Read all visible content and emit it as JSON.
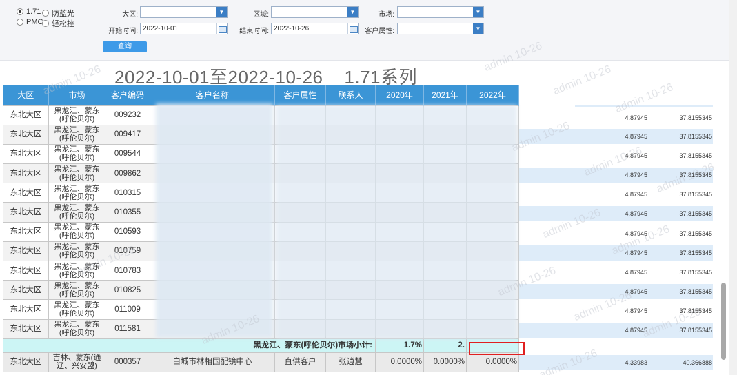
{
  "filters": {
    "radios": [
      {
        "label": "1.71",
        "checked": true
      },
      {
        "label": "防蓝光",
        "checked": false
      },
      {
        "label": "PMC",
        "checked": false
      },
      {
        "label": "轻松控",
        "checked": false
      }
    ],
    "region_label": "大区:",
    "area_label": "区域:",
    "market_label": "市场:",
    "start_label": "开始时间:",
    "start_value": "2022-10-01",
    "end_label": "结束时间:",
    "end_value": "2022-10-26",
    "attr_label": "客户属性:",
    "query_label": "查询"
  },
  "title": "2022-10-01至2022-10-26    1.71系列",
  "table": {
    "headers": [
      "大区",
      "市场",
      "客户编码",
      "客户名称",
      "客户属性",
      "联系人",
      "2020年",
      "2021年",
      "2022年"
    ],
    "rows": [
      {
        "region": "东北大区",
        "market": "黑龙江、蒙东(呼伦贝尔)",
        "code": "009232"
      },
      {
        "region": "东北大区",
        "market": "黑龙江、蒙东(呼伦贝尔)",
        "code": "009417"
      },
      {
        "region": "东北大区",
        "market": "黑龙江、蒙东(呼伦贝尔)",
        "code": "009544"
      },
      {
        "region": "东北大区",
        "market": "黑龙江、蒙东(呼伦贝尔)",
        "code": "009862"
      },
      {
        "region": "东北大区",
        "market": "黑龙江、蒙东(呼伦贝尔)",
        "code": "010315"
      },
      {
        "region": "东北大区",
        "market": "黑龙江、蒙东(呼伦贝尔)",
        "code": "010355"
      },
      {
        "region": "东北大区",
        "market": "黑龙江、蒙东(呼伦贝尔)",
        "code": "010593"
      },
      {
        "region": "东北大区",
        "market": "黑龙江、蒙东(呼伦贝尔)",
        "code": "010759"
      },
      {
        "region": "东北大区",
        "market": "黑龙江、蒙东(呼伦贝尔)",
        "code": "010783"
      },
      {
        "region": "东北大区",
        "market": "黑龙江、蒙东(呼伦贝尔)",
        "code": "010825"
      },
      {
        "region": "东北大区",
        "market": "黑龙江、蒙东(呼伦贝尔)",
        "code": "011009"
      },
      {
        "region": "东北大区",
        "market": "黑龙江、蒙东(呼伦贝尔)",
        "code": "011581"
      }
    ],
    "subtotal": {
      "label": "黑龙江、蒙东(呼伦贝尔)市场小计:",
      "y2020": "1.7%",
      "y2021": "2."
    },
    "last_row": {
      "region": "东北大区",
      "market": "吉林、蒙东(通辽、兴安盟)",
      "code": "000357",
      "name": "白城市林相国配镜中心",
      "attr": "直供客户",
      "contact": "张逍慧",
      "y2020": "0.0000%",
      "y2021": "0.0000%",
      "y2022": "0.0000%"
    }
  },
  "right_values": {
    "a": "4.87945",
    "b": "37.8155345",
    "last_a": "4.33983",
    "last_b": "40.366888"
  },
  "watermark": "admin 10-26"
}
